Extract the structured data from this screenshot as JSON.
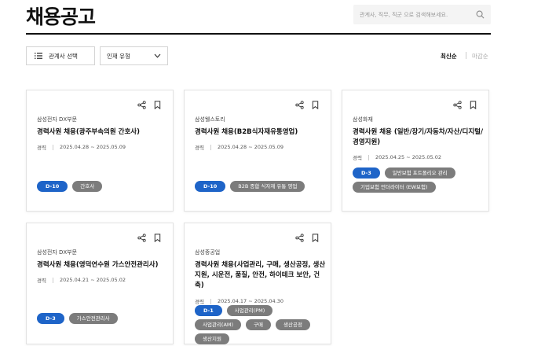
{
  "header": {
    "title": "채용공고",
    "search_placeholder": "관계사, 직무, 직군 으로 검색해보세요."
  },
  "filters": {
    "affiliate_label": "관계사 선택",
    "type_label": "인재 유형"
  },
  "sort": {
    "latest": "최신순",
    "deadline": "마감순"
  },
  "jobs": [
    {
      "company": "삼성전자 DX부문",
      "title": "경력사원 채용(광주부속의원 간호사)",
      "career": "경력",
      "period": "2025.04.28 ~ 2025.05.09",
      "dday": "D-10",
      "tags": [
        "간호사"
      ]
    },
    {
      "company": "삼성웰스토리",
      "title": "경력사원 채용(B2B식자재유통영업)",
      "career": "경력",
      "period": "2025.04.28 ~ 2025.05.09",
      "dday": "D-10",
      "tags": [
        "B2B 종합 식자재 유통 영업"
      ]
    },
    {
      "company": "삼성화재",
      "title": "경력사원 채용 (일반/장기/자동차/자산/디지털/경영지원)",
      "career": "경력",
      "period": "2025.04.25 ~ 2025.05.02",
      "dday": "D-3",
      "tags": [
        "일반보험 포트폴리오 관리",
        "기업보험 언더라이터 (EW보험)"
      ]
    },
    {
      "company": "삼성전자 DX부문",
      "title": "경력사원 채용(영덕연수원 가스안전관리사)",
      "career": "경력",
      "period": "2025.04.21 ~ 2025.05.02",
      "dday": "D-3",
      "tags": [
        "가스안전관리사"
      ]
    },
    {
      "company": "삼성중공업",
      "title": "경력사원 채용(사업관리, 구매, 생산공정, 생산지원, 시운전, 품질, 안전, 하이테크 보안, 건축)",
      "career": "경력",
      "period": "2025.04.17 ~ 2025.04.30",
      "dday": "D-1",
      "tags": [
        "사업관리(PM)",
        "사업관리(AM)",
        "구매",
        "생산공정",
        "생산지원"
      ]
    }
  ],
  "colors": {
    "dday_badge": "#1e64c8",
    "tag": "#7c7c7c"
  },
  "icons": {
    "search": "search-icon",
    "list": "list-icon",
    "chevron": "chevron-down-icon",
    "share": "share-icon",
    "bookmark": "bookmark-icon"
  }
}
